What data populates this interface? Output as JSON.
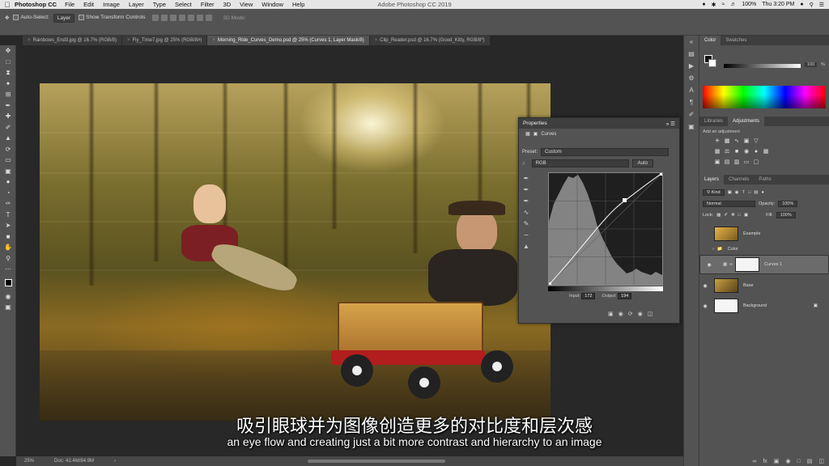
{
  "menubar": {
    "app_name": "Photoshop CC",
    "menus": [
      "File",
      "Edit",
      "Image",
      "Layer",
      "Type",
      "Select",
      "Filter",
      "3D",
      "View",
      "Window",
      "Help"
    ],
    "window_title": "Adobe Photoshop CC 2019",
    "battery": "100%",
    "clock": "Thu 3:20 PM"
  },
  "options": {
    "auto_select_label": "Auto-Select:",
    "auto_select_value": "Layer",
    "transform_label": "Show Transform Controls",
    "mode_label": "3D Mode:"
  },
  "tabs": [
    {
      "label": "Rainbows_End3.jpg @ 16.7% (RGB/8)",
      "active": false
    },
    {
      "label": "Fly_Time7.jpg @ 25% (RGB/8#)",
      "active": false
    },
    {
      "label": "Morning_Ride_Curves_Demo.psd @ 25% (Curves 1, Layer Mask/8)",
      "active": true
    },
    {
      "label": "Clip_Reader.psd @ 16.7% (Good_Kitty, RGB/8*)",
      "active": false
    }
  ],
  "tools": [
    "move-icon",
    "marquee-icon",
    "lasso-icon",
    "quick-select-icon",
    "crop-icon",
    "eyedropper-icon",
    "healing-icon",
    "brush-icon",
    "stamp-icon",
    "history-brush-icon",
    "eraser-icon",
    "gradient-icon",
    "blur-icon",
    "dodge-icon",
    "pen-icon",
    "type-icon",
    "path-select-icon",
    "shape-icon",
    "hand-icon",
    "zoom-icon",
    "edit-toolbar-icon"
  ],
  "status": {
    "zoom": "25%",
    "doc": "Doc: 42.4M/84.9M"
  },
  "subtitles": {
    "chinese": "吸引眼球并为图像创造更多的对比度和层次感",
    "english": "an eye flow and creating just a bit more contrast and hierarchy to an image"
  },
  "properties": {
    "title": "Properties",
    "adjustment": "Curves",
    "preset_label": "Preset:",
    "preset_value": "Custom",
    "channel_value": "RGB",
    "auto_label": "Auto",
    "input_label": "Input:",
    "input_value": "172",
    "output_label": "Output:",
    "output_value": "194"
  },
  "color_panel": {
    "tabs": [
      "Color",
      "Swatches"
    ],
    "gray_value": "100",
    "unit": "%"
  },
  "adjustments_panel": {
    "tabs": [
      "Libraries",
      "Adjustments"
    ],
    "add_label": "Add an adjustment"
  },
  "layers_panel": {
    "tabs": [
      "Layers",
      "Channels",
      "Paths"
    ],
    "kind_label": "Kind",
    "blend_mode": "Normal",
    "opacity_label": "Opacity:",
    "opacity_value": "100%",
    "lock_label": "Lock:",
    "fill_label": "Fill:",
    "fill_value": "100%",
    "layers": [
      {
        "name": "Example",
        "visible": false,
        "thumb": "#a86f27"
      },
      {
        "name": "Color",
        "visible": false,
        "thumb": "group"
      },
      {
        "name": "Curves 1",
        "visible": true,
        "thumb": "#f4f4f4"
      },
      {
        "name": "Base",
        "visible": true,
        "thumb": "#b0852f"
      },
      {
        "name": "Background",
        "visible": true,
        "thumb": "#f6f6f6"
      }
    ]
  }
}
